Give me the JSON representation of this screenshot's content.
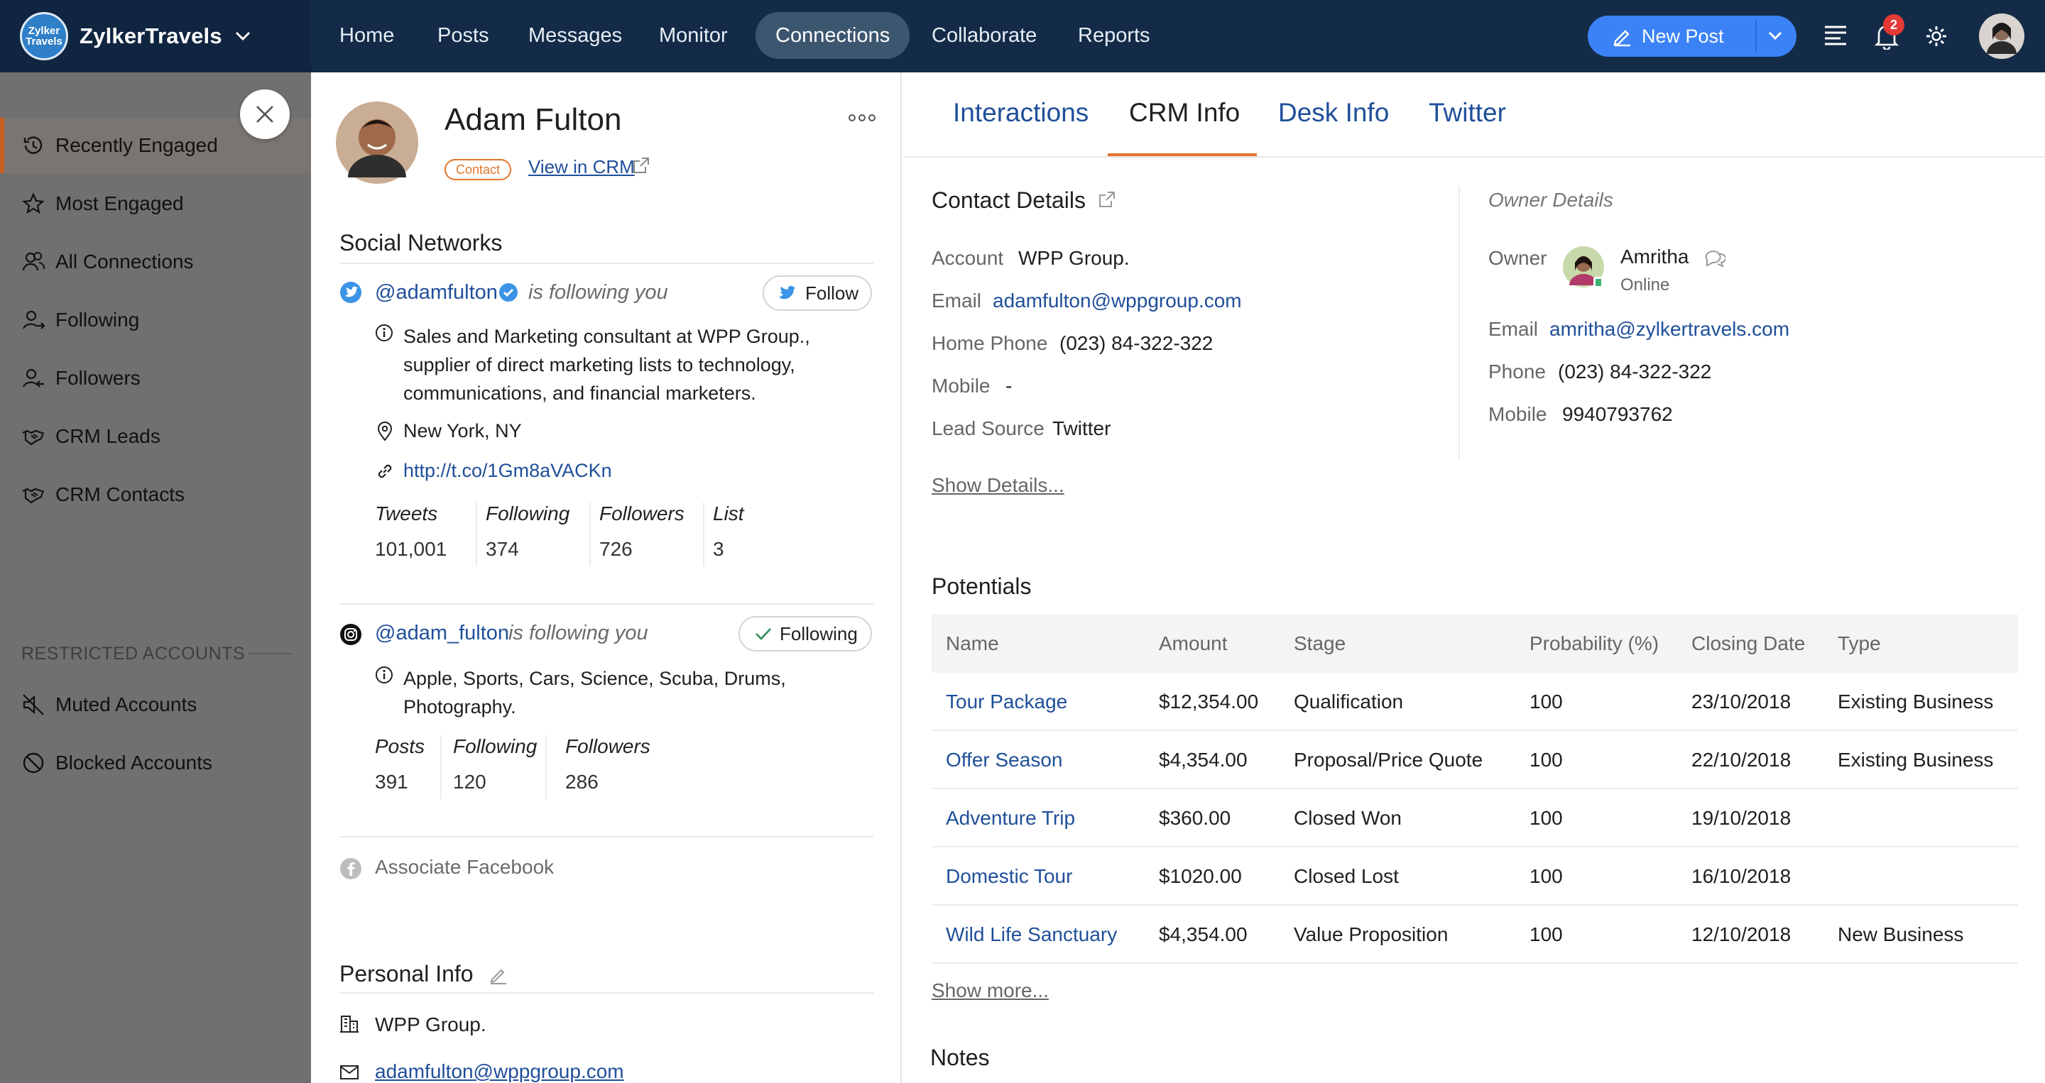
{
  "app": {
    "name": "ZylkerTravels",
    "logo_text": "Zylker Travels"
  },
  "nav": {
    "items": [
      "Home",
      "Posts",
      "Messages",
      "Monitor",
      "Connections",
      "Collaborate",
      "Reports"
    ],
    "active": "Connections",
    "new_post_label": "New Post",
    "notification_count": "2"
  },
  "sidebar": {
    "items": [
      {
        "label": "Recently Engaged",
        "icon": "history-icon"
      },
      {
        "label": "Most Engaged",
        "icon": "star-icon"
      },
      {
        "label": "All Connections",
        "icon": "users-icon"
      },
      {
        "label": "Following",
        "icon": "user-follow-icon"
      },
      {
        "label": "Followers",
        "icon": "user-follower-icon"
      },
      {
        "label": "CRM Leads",
        "icon": "handshake-icon"
      },
      {
        "label": "CRM Contacts",
        "icon": "handshake-icon"
      }
    ],
    "restricted_header": "RESTRICTED ACCOUNTS",
    "restricted_items": [
      {
        "label": "Muted Accounts",
        "icon": "mute-icon"
      },
      {
        "label": "Blocked Accounts",
        "icon": "block-icon"
      }
    ]
  },
  "contact": {
    "name": "Adam Fulton",
    "badge": "Contact",
    "view_in_crm": "View in CRM",
    "social_networks_title": "Social Networks",
    "twitter": {
      "handle": "@adamfulton",
      "following_note": "is following you",
      "follow_button": "Follow",
      "bio_line1": "Sales and Marketing consultant at WPP Group.,",
      "bio_line2": "supplier of direct marketing lists to technology,",
      "bio_line3": "communications, and financial marketers.",
      "location": "New York, NY",
      "url": "http://t.co/1Gm8aVACKn",
      "stats": [
        {
          "label": "Tweets",
          "value": "101,001"
        },
        {
          "label": "Following",
          "value": "374"
        },
        {
          "label": "Followers",
          "value": "726"
        },
        {
          "label": "List",
          "value": "3"
        }
      ]
    },
    "instagram": {
      "handle": "@adam_fulton",
      "following_note": "is following you",
      "following_button": "Following",
      "bio_line1": "Apple, Sports, Cars, Science, Scuba, Drums,",
      "bio_line2": "Photography.",
      "stats": [
        {
          "label": "Posts",
          "value": "391"
        },
        {
          "label": "Following",
          "value": "120"
        },
        {
          "label": "Followers",
          "value": "286"
        }
      ]
    },
    "associate_facebook": "Associate Facebook",
    "personal_info_title": "Personal Info",
    "personal_company": "WPP Group.",
    "personal_email": "adamfulton@wppgroup.com"
  },
  "tabs": {
    "items": [
      "Interactions",
      "CRM Info",
      "Desk Info",
      "Twitter"
    ],
    "active": "CRM Info"
  },
  "crm": {
    "contact_details_title": "Contact Details",
    "fields": [
      {
        "label": "Account",
        "value": "WPP Group."
      },
      {
        "label": "Email",
        "value": "adamfulton@wppgroup.com"
      },
      {
        "label": "Home Phone",
        "value": "(023) 84-322-322"
      },
      {
        "label": "Mobile",
        "value": "-"
      },
      {
        "label": "Lead Source",
        "value": "Twitter"
      }
    ],
    "show_details": "Show Details...",
    "owner_title": "Owner Details",
    "owner_label": "Owner",
    "owner_name": "Amritha",
    "owner_status": "Online",
    "owner_fields": [
      {
        "label": "Email",
        "value": "amritha@zylkertravels.com"
      },
      {
        "label": "Phone",
        "value": "(023) 84-322-322"
      },
      {
        "label": "Mobile",
        "value": "9940793762"
      }
    ],
    "potentials_title": "Potentials",
    "potentials_columns": [
      "Name",
      "Amount",
      "Stage",
      "Probability (%)",
      "Closing Date",
      "Type"
    ],
    "potentials_rows": [
      [
        "Tour Package",
        "$12,354.00",
        "Qualification",
        "100",
        "23/10/2018",
        "Existing Business"
      ],
      [
        "Offer Season",
        "$4,354.00",
        "Proposal/Price Quote",
        "100",
        "22/10/2018",
        "Existing Business"
      ],
      [
        "Adventure Trip",
        "$360.00",
        "Closed Won",
        "100",
        "19/10/2018",
        ""
      ],
      [
        "Domestic Tour",
        "$1020.00",
        "Closed Lost",
        "100",
        "16/10/2018",
        ""
      ],
      [
        "Wild Life Sanctuary",
        "$4,354.00",
        "Value Proposition",
        "100",
        "12/10/2018",
        "New Business"
      ]
    ],
    "show_more": "Show more...",
    "notes_title": "Notes"
  },
  "colors": {
    "topbar": "#132b47",
    "accent_blue": "#3b82f6",
    "link": "#1f4f9a",
    "active_tab_underline": "#e2762a",
    "sidebar_overlay": "#707070"
  }
}
